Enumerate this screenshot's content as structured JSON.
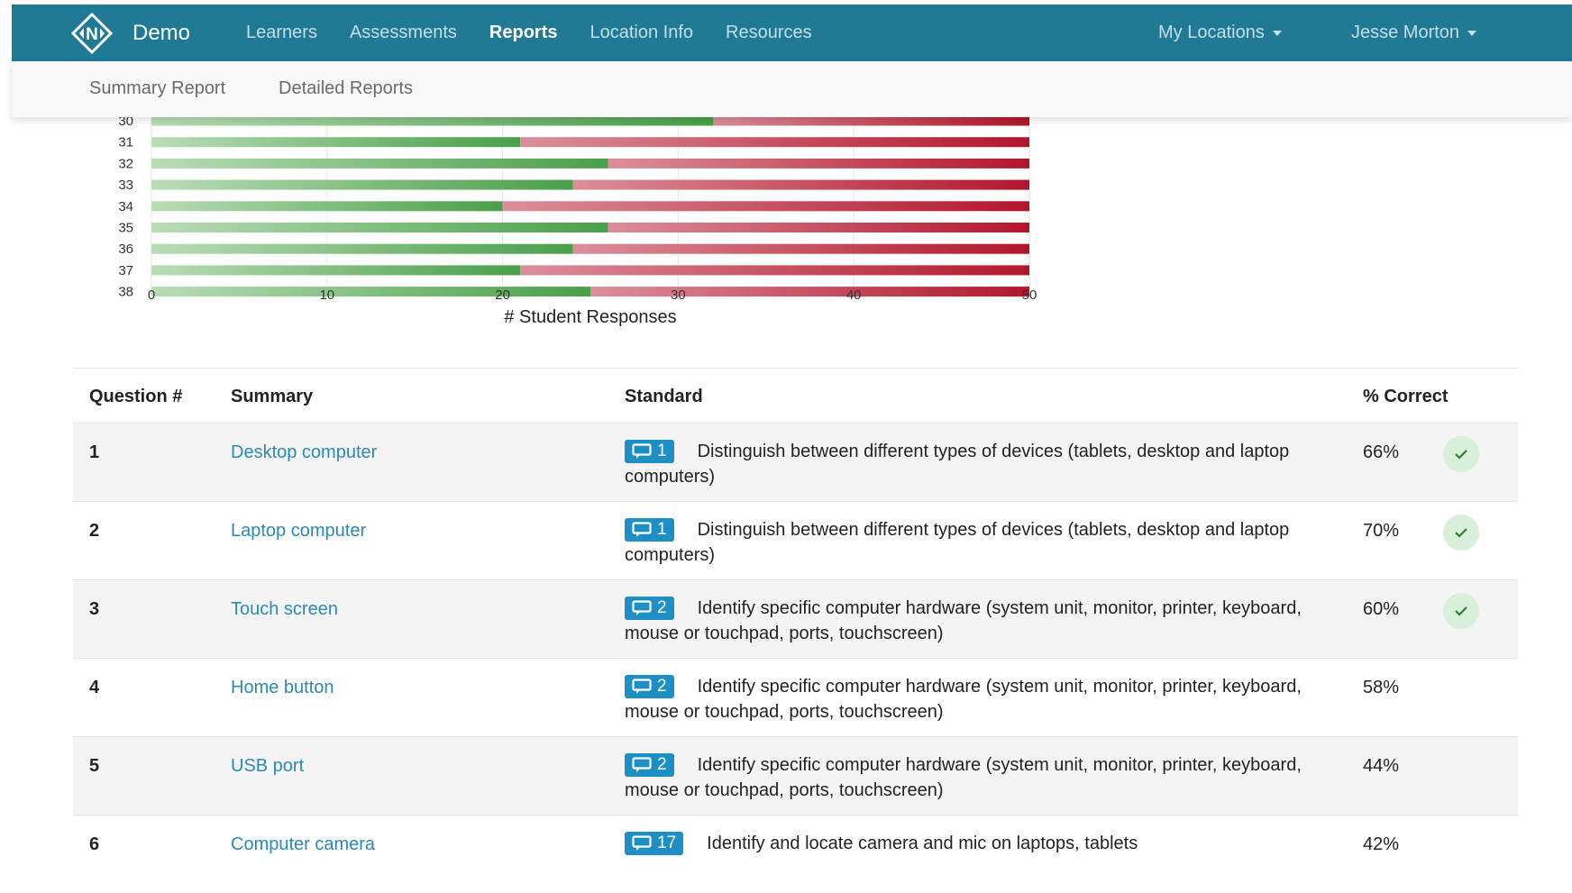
{
  "navbar": {
    "brand": "Demo",
    "links": [
      "Learners",
      "Assessments",
      "Reports",
      "Location Info",
      "Resources"
    ],
    "active_link": "Reports",
    "my_locations": "My Locations",
    "user": "Jesse Morton"
  },
  "subnav": {
    "summary_report": "Summary Report",
    "detailed_reports": "Detailed Reports"
  },
  "colors": {
    "navbar": "#207a96",
    "correct": "#4a9f4a",
    "incorrect": "#b3162b",
    "link": "#2a8ab3",
    "badge": "#1d8fc4"
  },
  "chart_data": {
    "type": "bar",
    "orientation": "horizontal",
    "stacked": true,
    "categories": [
      "30",
      "31",
      "32",
      "33",
      "34",
      "35",
      "36",
      "37",
      "38"
    ],
    "series": [
      {
        "values": [
          32,
          21,
          26,
          24,
          20,
          26,
          24,
          21,
          25
        ]
      },
      {
        "values": [
          18,
          29,
          24,
          26,
          30,
          24,
          26,
          29,
          25
        ]
      }
    ],
    "xlabel": "# Student Responses",
    "ylabel": "",
    "xlim": [
      0,
      50
    ],
    "xticks": [
      0,
      10,
      20,
      30,
      40,
      50
    ],
    "grid": true,
    "legend": "none"
  },
  "table": {
    "headers": {
      "question": "Question #",
      "summary": "Summary",
      "standard": "Standard",
      "correct": "% Correct"
    },
    "rows": [
      {
        "num": "1",
        "summary": "Desktop computer",
        "badge": "1",
        "standard": "Distinguish between different types of devices (tablets, desktop and laptop computers)",
        "pct": "66%",
        "check": true
      },
      {
        "num": "2",
        "summary": "Laptop computer",
        "badge": "1",
        "standard": "Distinguish between different types of devices (tablets, desktop and laptop computers)",
        "pct": "70%",
        "check": true
      },
      {
        "num": "3",
        "summary": "Touch screen",
        "badge": "2",
        "standard": "Identify specific computer hardware (system unit, monitor, printer, keyboard, mouse or touchpad, ports, touchscreen)",
        "pct": "60%",
        "check": true
      },
      {
        "num": "4",
        "summary": "Home button",
        "badge": "2",
        "standard": "Identify specific computer hardware (system unit, monitor, printer, keyboard, mouse or touchpad, ports, touchscreen)",
        "pct": "58%",
        "check": false
      },
      {
        "num": "5",
        "summary": "USB port",
        "badge": "2",
        "standard": "Identify specific computer hardware (system unit, monitor, printer, keyboard, mouse or touchpad, ports, touchscreen)",
        "pct": "44%",
        "check": false
      },
      {
        "num": "6",
        "summary": "Computer camera",
        "badge": "17",
        "standard": "Identify and locate camera and mic on laptops, tablets",
        "pct": "42%",
        "check": false
      }
    ]
  }
}
